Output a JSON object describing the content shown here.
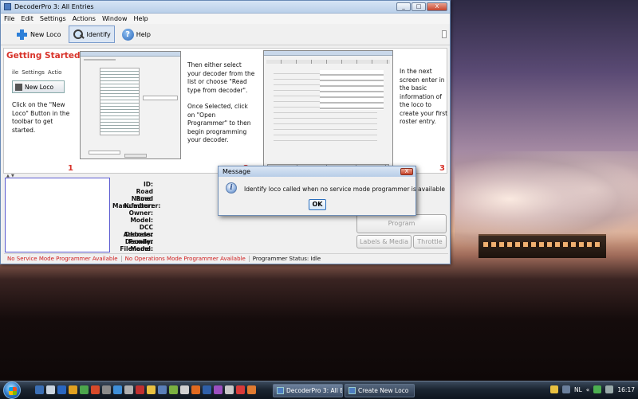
{
  "window": {
    "title": "DecoderPro 3: All Entries",
    "controls": [
      "_",
      "□",
      "X"
    ]
  },
  "menubar": [
    "File",
    "Edit",
    "Settings",
    "Actions",
    "Window",
    "Help"
  ],
  "toolbar": {
    "new_loco": "New Loco",
    "identify": "Identify",
    "help": "Help"
  },
  "getting_started": {
    "title": "Getting Started",
    "menu_sample": [
      "ile",
      "Settings",
      "Actio"
    ],
    "newloco_sample": "New Loco",
    "step1_text": "Click on the \"New Loco\" Button in the toolbar to get started.",
    "step2_text": "Then either select your decoder from the list or choose \"Read type from decoder\".",
    "step2b_text": "Once Selected, click on \"Open Programmer\" to then begin programming your decoder.",
    "step3_text": "In the next screen enter in the basic information of the loco to create your first roster entry.",
    "step_numbers": [
      "1",
      "2",
      "3"
    ]
  },
  "roster_fields": [
    "ID:",
    "Road Name:",
    "Road Number:",
    "Manufacturer:",
    "Owner:",
    "Model:",
    "DCC Address:",
    "Decoder Family:",
    "Decoder Model:",
    "Filename:"
  ],
  "buttons": {
    "program": "Program",
    "labels_media": "Labels & Media",
    "throttle": "Throttle"
  },
  "status": {
    "service": "No Service Mode Programmer Available",
    "ops": "No Operations Mode Programmer Available",
    "programmer": "Programmer Status:  Idle"
  },
  "dialog": {
    "title": "Message",
    "close": "X",
    "icon_letter": "i",
    "message": "Identify loco called when no service mode programmer is available",
    "ok": "OK"
  },
  "taskbar": {
    "tasks": [
      "DecoderPro 3: All Ent...",
      "Create New Loco"
    ],
    "language": "NL",
    "time": "16:17",
    "arrow": "«"
  },
  "colors": {
    "accent_red": "#d8332a",
    "window_blue": "#b9cfe9",
    "taskbar": "#1b2531"
  },
  "icons": {
    "new_loco": "plus-icon",
    "identify": "magnifier-icon",
    "help": "help-icon",
    "dialog": "info-icon"
  }
}
